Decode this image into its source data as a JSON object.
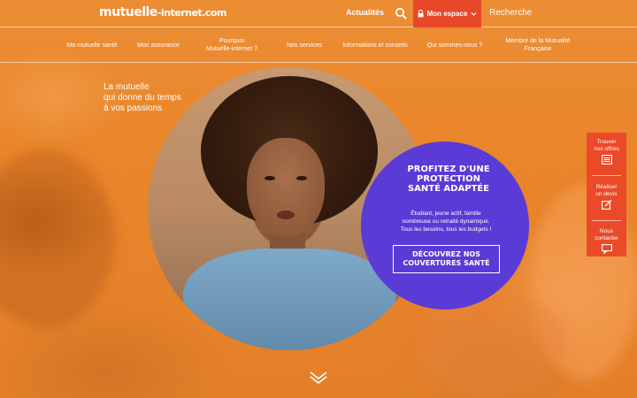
{
  "header": {
    "logo_main": "mutuelle",
    "logo_mid": "-internet",
    "logo_tld": ".com",
    "news_label": "Actualités",
    "espace_label": "Mon espace",
    "search_label": "Recherche"
  },
  "nav": {
    "items": [
      {
        "label": "Ma mutuelle santé"
      },
      {
        "label": "Mon assurance"
      },
      {
        "line1": "Pourquoi",
        "line2": "Mutuelle-internet ?"
      },
      {
        "label": "Nos services"
      },
      {
        "label": "Informations et conseils"
      },
      {
        "label": "Qui sommes-nous ?"
      },
      {
        "line1": "Membre de la Mutualité",
        "line2": "Française"
      }
    ]
  },
  "hero": {
    "tagline": [
      "La mutuelle",
      "qui donne du temps",
      "à vos passions"
    ]
  },
  "promo": {
    "title": [
      "PROFITEZ D'UNE",
      "PROTECTION",
      "SANTÉ ADAPTÉE"
    ],
    "text": [
      "Étudiant, jeune actif, famille",
      "nombreuse ou retraité dynamique.",
      "Tous les besoins, tous les budgets !"
    ],
    "button": [
      "DÉCOUVREZ NOS",
      "COUVERTURES SANTÉ"
    ]
  },
  "side": {
    "items": [
      {
        "line1": "Trouver",
        "line2": "nos offres",
        "icon": "list-icon"
      },
      {
        "line1": "Réaliser",
        "line2": "un devis",
        "icon": "edit-icon"
      },
      {
        "line1": "Nous",
        "line2": "contacter",
        "icon": "chat-icon"
      }
    ]
  },
  "colors": {
    "orange": "#e9862c",
    "red": "#e9472a",
    "purple": "#5a3bd6"
  }
}
